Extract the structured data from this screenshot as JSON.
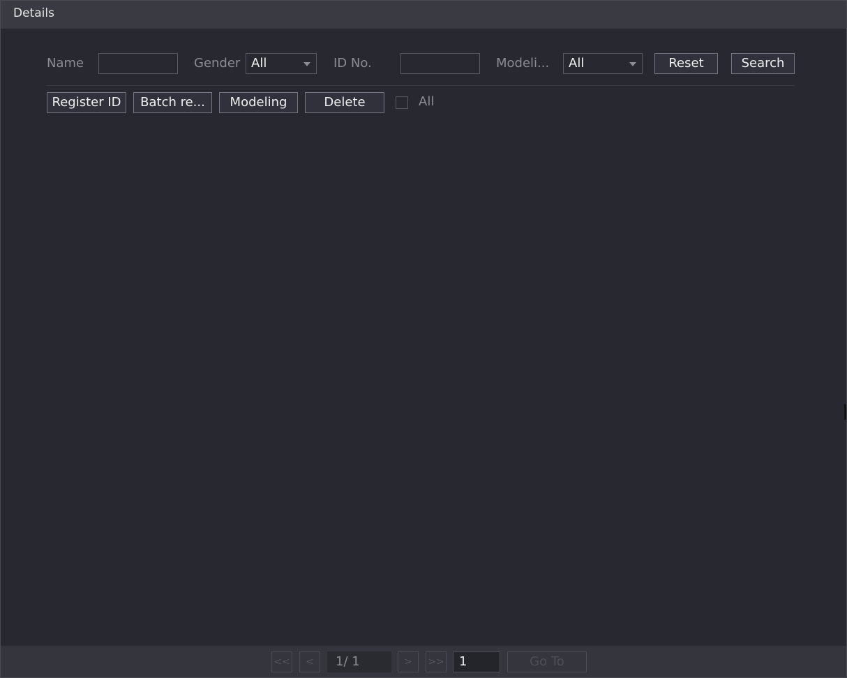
{
  "window": {
    "title": "Details"
  },
  "filters": {
    "name_label": "Name",
    "name_value": "",
    "gender_label": "Gender",
    "gender_value": "All",
    "id_label": "ID No.",
    "id_value": "",
    "modeling_label": "Modeli...",
    "modeling_value": "All",
    "reset_label": "Reset",
    "search_label": "Search"
  },
  "toolbar": {
    "register_label": "Register ID",
    "batch_label": "Batch re...",
    "modeling_label": "Modeling",
    "delete_label": "Delete",
    "all_label": "All"
  },
  "pagination": {
    "first": "<<",
    "prev": "<",
    "page_info": "1/  1",
    "next": ">",
    "last": ">>",
    "goto_value": "1",
    "goto_label": "Go To"
  },
  "colors": {
    "background": "#282930",
    "titlebar": "#3a3b42",
    "text": "#f0f0f0",
    "muted": "#8c8d94"
  }
}
